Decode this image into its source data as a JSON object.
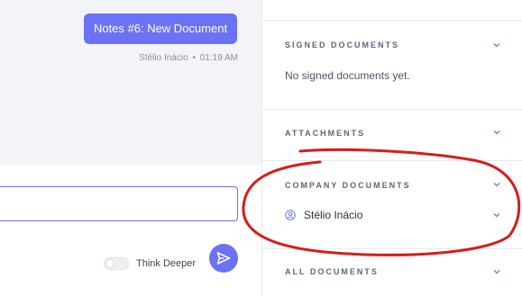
{
  "chat": {
    "message": "Notes #6: New Document",
    "author": "Stélio Inácio",
    "separator": "•",
    "time": "01:19 AM"
  },
  "composer": {
    "input_value": "",
    "input_placeholder": "",
    "toggle_label": "Think Deeper",
    "think_deeper_on": false
  },
  "sidebar": {
    "signed": {
      "title": "SIGNED DOCUMENTS",
      "empty_text": "No signed documents yet."
    },
    "attachments": {
      "title": "ATTACHMENTS"
    },
    "company": {
      "title": "COMPANY DOCUMENTS",
      "item_label": "Stélio Inácio"
    },
    "all": {
      "title": "ALL DOCUMENTS"
    }
  },
  "colors": {
    "accent": "#6b72f5",
    "annotation": "#d81b1b"
  }
}
